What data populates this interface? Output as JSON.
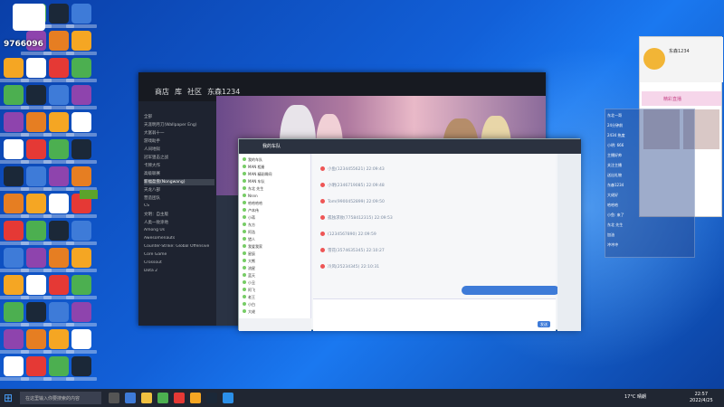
{
  "colors": {
    "accent": "#3e7bd8",
    "steam_bg": "#1b2838",
    "taskbar": "#202632",
    "play_green": "#5ba32b"
  },
  "overlay": {
    "badge_number": "9766096"
  },
  "steam": {
    "nav_items": [
      "商店",
      "库",
      "社区",
      "东森1234"
    ],
    "sidebar_rows": [
      "全部",
      "天涯明月刀(Wallpaper Eng)",
      "大富翁十一",
      "游戏助手",
      "人间地狱",
      "冠军狙击之战",
      "卡牌大作",
      "高级联赛",
      "新福盈盘(Nongwang)",
      "天龙八部",
      "营造团队",
      "CS",
      "文明：自主版",
      "人类一败涂地",
      "Among Us",
      "Awesomenauts",
      "Counter-Strike: Global Offensive",
      "Core Game",
      "Crossout",
      "Dota 2"
    ],
    "play_label": ""
  },
  "chat": {
    "title": "我的车队",
    "left_rows": [
      "我的车队",
      "MAN 相册",
      "MAN 精彩瞬间",
      "MAN 车队",
      "东北 先生",
      "Nnnn",
      "哈哈哈哈",
      "卢本伟",
      "小蒋",
      "东方",
      "阿浩",
      "猎人",
      "我爱我家",
      "星辰",
      "大熊",
      "流星",
      "蓝天",
      "小丑",
      "阿飞",
      "老王",
      "小白",
      "大佬"
    ],
    "messages": [
      "小鱼(1234455621)  22:09:43",
      "小明(2346719085)  22:09:48",
      "Tom(9900452899)  22:09:50",
      "孤独求败(7758412315)  22:09:53",
      "(1234567890)  22:09:59",
      "雪花(3574635345)  22:10:27",
      "冷风(25234345)  22:10:31"
    ],
    "bubble_text": "",
    "input_placeholder": "",
    "send_label": "发送"
  },
  "qq": {
    "name": "东森1234",
    "pink_bar": "精彩直播"
  },
  "live": {
    "lines": [
      "东北一哥",
      "24分钟前",
      "2434 热度",
      "小明: 666",
      "主播好帅",
      "关注主播",
      "送出礼物",
      "东森1234",
      "大佬好",
      "哈哈哈",
      "小鱼: 来了",
      "东北 先生",
      "加油",
      "冲冲冲"
    ]
  },
  "taskbar": {
    "search_placeholder": "在这里输入你要搜索的内容",
    "tray_text": "17°C 晴朗",
    "time": "22:57",
    "date": "2022/4/25"
  }
}
